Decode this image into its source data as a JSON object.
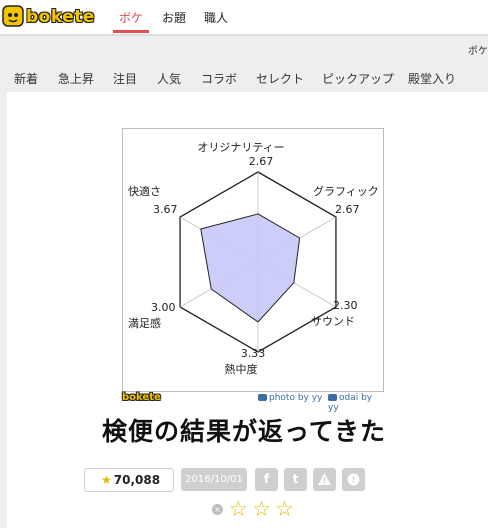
{
  "header": {
    "logo_text": "bokete",
    "tabs": [
      {
        "label": "ボケ",
        "active": true
      },
      {
        "label": "お題",
        "active": false
      },
      {
        "label": "職人",
        "active": false
      }
    ],
    "right_link": "ボケ"
  },
  "categories": [
    "新着",
    "急上昇",
    "注目",
    "人気",
    "コラボ",
    "セレクト",
    "ピックアップ",
    "殿堂入り"
  ],
  "chart_data": {
    "type": "radar",
    "axes": [
      {
        "label": "オリジナリティー",
        "value": "2.67"
      },
      {
        "label": "グラフィック",
        "value": "2.67"
      },
      {
        "label": "サウンド",
        "value": "2.30"
      },
      {
        "label": "熱中度",
        "value": "3.33"
      },
      {
        "label": "満足感",
        "value": "3.00"
      },
      {
        "label": "快適さ",
        "value": "3.67"
      }
    ],
    "values": [
      2.67,
      2.67,
      2.3,
      3.33,
      3.0,
      3.67
    ],
    "max": 5,
    "fill_color": "#c8c8f8",
    "stroke_color": "#222222"
  },
  "image_credits": {
    "brand": "bokete",
    "photo": "photo by yy",
    "odai": "odai by yy"
  },
  "post": {
    "caption": "検便の結果が返ってきた",
    "stars": "70,088",
    "date": "2016/10/01"
  },
  "share_icons": [
    "facebook-icon",
    "twitter-icon",
    "warning-icon",
    "info-icon"
  ],
  "share_glyphs": [
    "f",
    "t",
    "!",
    "!"
  ],
  "rating": {
    "clear_glyph": "×",
    "star_glyph": "☆"
  }
}
